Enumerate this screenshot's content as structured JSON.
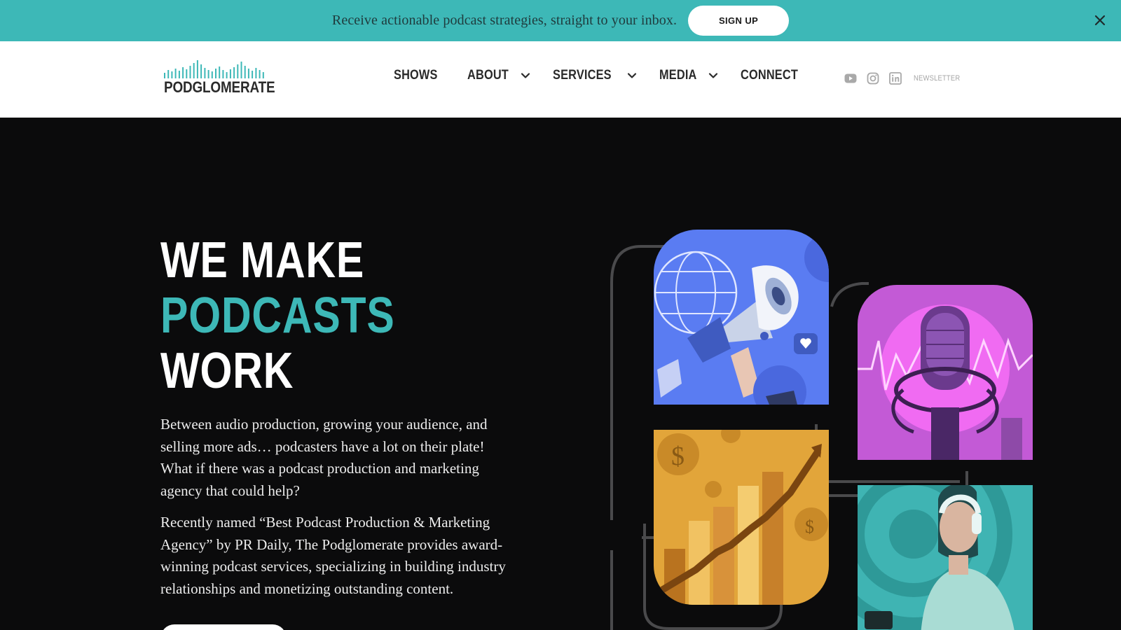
{
  "announcement": {
    "text": "Receive actionable podcast strategies, straight to your inbox.",
    "signup_label": "SIGN UP",
    "close_icon": "close-icon"
  },
  "header": {
    "logo_text": "PODGLOMERATE",
    "nav": [
      {
        "label": "SHOWS",
        "has_dropdown": false
      },
      {
        "label": "ABOUT",
        "has_dropdown": true
      },
      {
        "label": "SERVICES",
        "has_dropdown": true
      },
      {
        "label": "MEDIA",
        "has_dropdown": true
      },
      {
        "label": "CONNECT",
        "has_dropdown": false
      }
    ],
    "social_icons": [
      "youtube-icon",
      "instagram-icon",
      "linkedin-icon"
    ],
    "newsletter_label": "NEWSLETTER"
  },
  "hero": {
    "headline": [
      "WE MAKE",
      "PODCASTS",
      "WORK"
    ],
    "paragraphs": [
      "Between audio production, growing your audience, and selling more ads… podcasters have a lot on their plate! What if there was a podcast production and marketing agency that could help?",
      "Recently named “Best Podcast Production & Marketing Agency” by PR Daily, The Podglomerate provides award-winning podcast services, specializing in building industry relationships and monetizing outstanding content."
    ]
  },
  "colors": {
    "teal": "#3db8b7",
    "background": "#0b0b0c",
    "header_bg": "#ffffff",
    "tile_blue": "#5a7cf2",
    "tile_magenta": "#c35ad6",
    "tile_gold": "#e2a53a",
    "tile_teal": "#3fb4b3"
  }
}
